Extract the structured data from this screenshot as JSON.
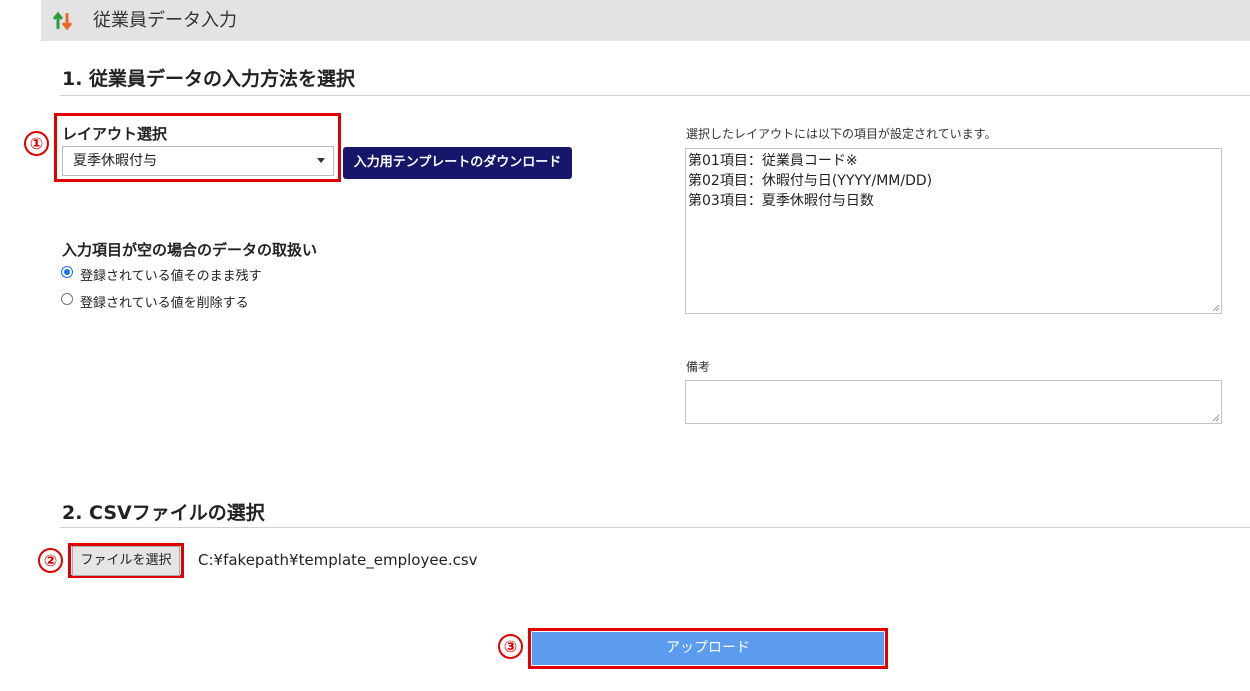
{
  "header": {
    "title": "従業員データ入力",
    "icon": "sort-arrows-icon"
  },
  "section1": {
    "heading": "1. 従業員データの入力方法を選択"
  },
  "layout_select": {
    "label": "レイアウト選択",
    "value": "夏季休暇付与",
    "badge": "①"
  },
  "download_button": {
    "label": "入力用テンプレートのダウンロード"
  },
  "empty_handling": {
    "label": "入力項目が空の場合のデータの取扱い",
    "options": [
      {
        "label": "登録されている値そのまま残す",
        "checked": true
      },
      {
        "label": "登録されている値を削除する",
        "checked": false
      }
    ]
  },
  "layout_items": {
    "label": "選択したレイアウトには以下の項目が設定されています。",
    "lines": [
      "第01項目：従業員コード※",
      "第02項目：休暇付与日(YYYY/MM/DD)",
      "第03項目：夏季休暇付与日数"
    ]
  },
  "remarks": {
    "label": "備考",
    "value": ""
  },
  "section2": {
    "heading": "2. CSVファイルの選択"
  },
  "file_input": {
    "button_label": "ファイルを選択",
    "path": "C:¥fakepath¥template_employee.csv",
    "badge": "②"
  },
  "upload_button": {
    "label": "アップロード",
    "badge": "③"
  },
  "colors": {
    "accent_red": "#e00000",
    "download_bg": "#16166b",
    "upload_bg": "#5b9cf0"
  }
}
